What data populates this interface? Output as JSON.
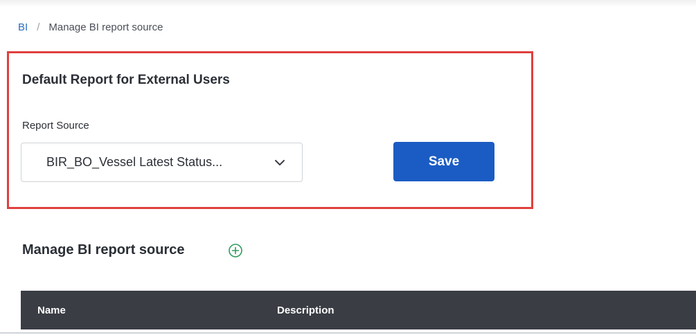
{
  "breadcrumb": {
    "root": "BI",
    "separator": "/",
    "current": "Manage BI report source"
  },
  "default_report": {
    "title": "Default Report for External Users",
    "field_label": "Report Source",
    "selected_value": "BIR_BO_Vessel Latest Status...",
    "save_label": "Save"
  },
  "manage": {
    "title": "Manage BI report source",
    "table": {
      "columns": [
        "Name",
        "Description"
      ]
    }
  },
  "colors": {
    "accent": "#1b5cc4",
    "highlight": "#e0403d",
    "header_bg": "#3a3d44",
    "add_icon": "#2e9b5e"
  },
  "icons": {
    "dropdown": "chevron-down-icon",
    "add": "plus-circle-icon"
  }
}
